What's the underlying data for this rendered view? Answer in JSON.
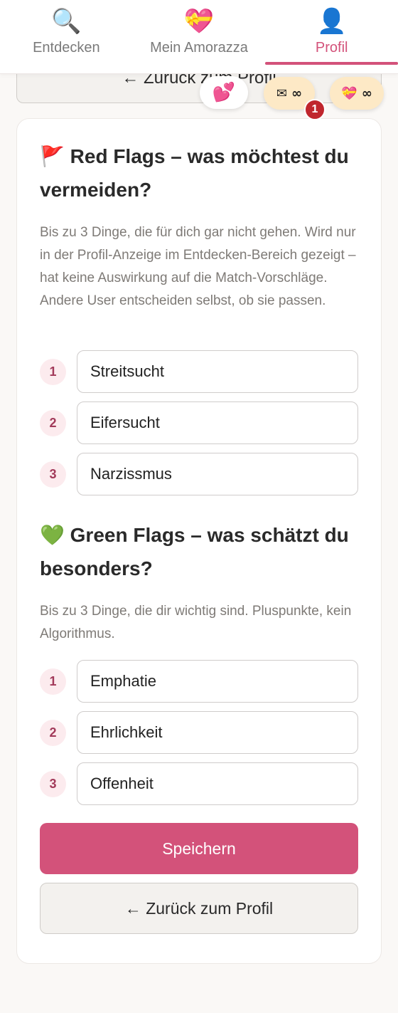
{
  "nav": {
    "tabs": [
      {
        "label": "Entdecken",
        "icon": "🔍",
        "active": false
      },
      {
        "label": "Mein Amorazza",
        "icon": "💝",
        "active": true
      },
      {
        "label": "Profil",
        "icon": "👤",
        "active": true
      }
    ]
  },
  "badges": {
    "hearts_icon": "💕",
    "mail_text": "✉ ∞",
    "gift_text": "💝 ∞",
    "unread_count": "1"
  },
  "back_top_label": "← Zurück zum Profil",
  "red_flags": {
    "emoji": "🚩",
    "title": "Red Flags – was möchtest du vermeiden?",
    "description": "Bis zu 3 Dinge, die für dich gar nicht gehen. Wird nur in der Profil-Anzeige im Entdecken-Bereich gezeigt – hat keine Auswirkung auf die Match-Vorschläge. Andere User entscheiden selbst, ob sie passen.",
    "items": [
      {
        "num": "1",
        "value": "Streitsucht"
      },
      {
        "num": "2",
        "value": "Eifersucht"
      },
      {
        "num": "3",
        "value": "Narzissmus"
      }
    ]
  },
  "green_flags": {
    "emoji": "💚",
    "title": "Green Flags – was schätzt du besonders?",
    "description": "Bis zu 3 Dinge, die dir wichtig sind. Pluspunkte, kein Algorithmus.",
    "items": [
      {
        "num": "1",
        "value": "Emphatie"
      },
      {
        "num": "2",
        "value": "Ehrlichkeit"
      },
      {
        "num": "3",
        "value": "Offenheit"
      }
    ]
  },
  "buttons": {
    "save": "Speichern",
    "back": "← Zurück zum Profil"
  },
  "colors": {
    "accent": "#d3527a",
    "badge_bg": "#fde9c6",
    "notification": "#c0262d"
  }
}
